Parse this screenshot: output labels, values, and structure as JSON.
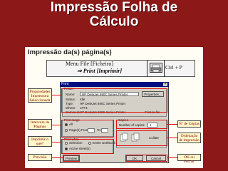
{
  "slide": {
    "title_line1": "Impressão Folha de",
    "title_line2": "Cálculo"
  },
  "panel": {
    "title": "Impressão da(s) página(s)",
    "menu_path": "Menu File [Ficheiro]",
    "menu_item": "⇒ Print [Imprimir]",
    "shortcut": "Ctrl + P",
    "printer_icon": "printer-icon"
  },
  "dialog": {
    "title": "Print",
    "printer_group": "Printer",
    "name_label": "Name:",
    "name_value": "HP DeskJet 690C Series Printer",
    "properties_button": "Properties...",
    "status_label": "Status:",
    "status_value": "Idle",
    "type_label": "Type:",
    "type_value": "HP DeskJet 690C Series Printer",
    "where_label": "Where:",
    "where_value": "LPT1:",
    "comment_label": "Comment:",
    "comment_value": "HP DeskJet 690C Series Printer",
    "print_to_file_label": "Print to file",
    "print_range_group": "Print range",
    "range_all": "All",
    "range_pages": "Page(s)",
    "from_label": "From:",
    "to_label": "To:",
    "copies_group": "Copies",
    "copies_label": "Number of copies:",
    "copies_value": "1",
    "collate_label": "Collate",
    "print_what_group": "Print what",
    "what_selection": "Selection",
    "what_workbook": "Entire workbook",
    "what_active": "Active sheet(s)",
    "preview_button": "Preview",
    "ok_button": "OK",
    "cancel_button": "Cancel"
  },
  "callouts": {
    "properties": "Propriedades Impressora Seleccionada",
    "range": "Intervalo de Páginas",
    "what": "Imprimir o quê?",
    "preview": "Previsão",
    "copies": "Nº de Cópias",
    "order": "Ordenação de impressão",
    "ok_close": "OK ou Fechar"
  },
  "colors": {
    "background": "#8c1818",
    "panel": "#fffdf4",
    "highlight": "#e01010",
    "callout_fill": "#fff9c9"
  }
}
